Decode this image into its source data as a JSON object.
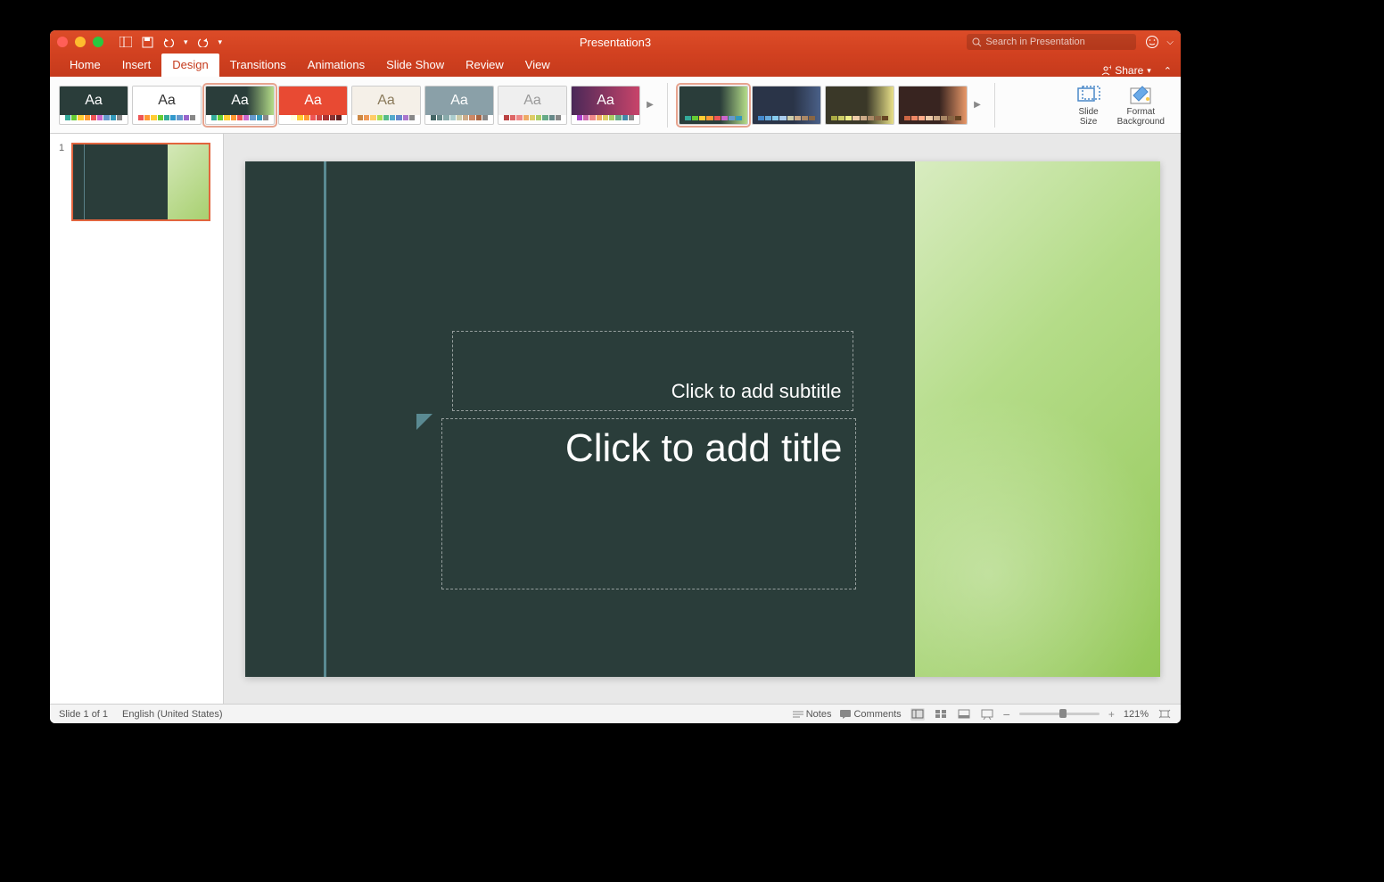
{
  "title": "Presentation3",
  "search_placeholder": "Search in Presentation",
  "tabs": [
    "Home",
    "Insert",
    "Design",
    "Transitions",
    "Animations",
    "Slide Show",
    "Review",
    "View"
  ],
  "active_tab": "Design",
  "share_label": "Share",
  "themes": [
    {
      "bg": "#2a3d3a",
      "fg": "#fff",
      "colors": [
        "#3a9",
        "#6c3",
        "#fc3",
        "#f93",
        "#e55",
        "#c6c",
        "#69c",
        "#39b",
        "#888"
      ]
    },
    {
      "bg": "#ffffff",
      "fg": "#333",
      "colors": [
        "#e55",
        "#f93",
        "#fc3",
        "#6c3",
        "#3a9",
        "#39c",
        "#69c",
        "#96c",
        "#888"
      ]
    },
    {
      "bg": "#2a3d3a",
      "fg": "#fff",
      "sel": true,
      "grad": "linear-gradient(90deg,#2a3d3a 60%,#b4dc88)",
      "colors": [
        "#3a9",
        "#6c3",
        "#fc3",
        "#f93",
        "#e55",
        "#c6c",
        "#69c",
        "#39b",
        "#888"
      ]
    },
    {
      "bg": "#e84a33",
      "fg": "#fff",
      "colors": [
        "#fff",
        "#ffd",
        "#fc3",
        "#f93",
        "#e55",
        "#c44",
        "#a33",
        "#833",
        "#622"
      ]
    },
    {
      "bg": "#f5f0e8",
      "fg": "#8a7a5a",
      "colors": [
        "#c84",
        "#e95",
        "#fc6",
        "#ad5",
        "#5b8",
        "#5ac",
        "#68c",
        "#a7c",
        "#888"
      ]
    },
    {
      "bg": "#8aa0a8",
      "fg": "#fff",
      "colors": [
        "#466",
        "#688",
        "#8aa",
        "#acc",
        "#cca",
        "#ca8",
        "#c86",
        "#a64",
        "#888"
      ]
    },
    {
      "bg": "#efefef",
      "fg": "#999",
      "colors": [
        "#b44",
        "#d66",
        "#e88",
        "#ea6",
        "#dc6",
        "#ac6",
        "#6a8",
        "#688",
        "#888"
      ]
    },
    {
      "bg": "#4a2858",
      "fg": "#fff",
      "grad": "linear-gradient(90deg,#4a2858,#c8446a)",
      "colors": [
        "#a4c",
        "#c6a",
        "#e88",
        "#ea6",
        "#dc6",
        "#ac6",
        "#6a8",
        "#48a",
        "#888"
      ]
    }
  ],
  "variants": [
    {
      "sel": true,
      "bg": "linear-gradient(90deg,#2a3d3a 60%,#b4dc88)",
      "colors": [
        "#3a9",
        "#6c3",
        "#fc3",
        "#f93",
        "#e55",
        "#c6c",
        "#69c",
        "#39b"
      ]
    },
    {
      "bg": "linear-gradient(90deg,#2a3448 60%,#4a6088)",
      "colors": [
        "#48c",
        "#6ad",
        "#8ce",
        "#ace",
        "#cca",
        "#ca8",
        "#a86",
        "#864"
      ]
    },
    {
      "bg": "linear-gradient(90deg,#3a3828 60%,#e8e088)",
      "colors": [
        "#aa4",
        "#cc6",
        "#ee8",
        "#eca",
        "#ca8",
        "#a86",
        "#864",
        "#642"
      ]
    },
    {
      "bg": "linear-gradient(90deg,#382420 60%,#e89868)",
      "colors": [
        "#c64",
        "#e86",
        "#fa8",
        "#eca",
        "#ca8",
        "#a86",
        "#864",
        "#642"
      ]
    }
  ],
  "ribbon_buttons": {
    "slide_size": "Slide\nSize",
    "format_bg": "Format\nBackground"
  },
  "thumbnail_number": "1",
  "slide": {
    "subtitle_placeholder": "Click to add subtitle",
    "title_placeholder": "Click to add title"
  },
  "status": {
    "slide": "Slide 1 of 1",
    "lang": "English (United States)",
    "notes": "Notes",
    "comments": "Comments",
    "zoom": "121%"
  }
}
